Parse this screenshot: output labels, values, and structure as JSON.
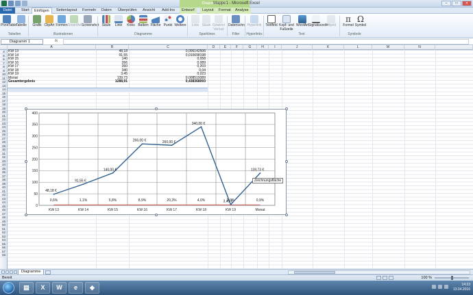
{
  "window": {
    "title": "Mappe1 - Microsoft Excel",
    "context_tool": "Diagrammtools",
    "controls": [
      "–",
      "□",
      "✕"
    ]
  },
  "tabs": [
    "Datei",
    "Start",
    "Einfügen",
    "Seitenlayout",
    "Formeln",
    "Daten",
    "Überprüfen",
    "Ansicht",
    "Add-Ins",
    "Entwurf",
    "Layout",
    "Format",
    "Analyse"
  ],
  "ribbon": {
    "buttons": [
      {
        "label": "PivotTable",
        "icon": "pivottable-icon"
      },
      {
        "label": "Tabelle",
        "icon": "table-icon"
      },
      {
        "label": "Grafik",
        "icon": "picture-icon"
      },
      {
        "label": "ClipArt",
        "icon": "clipart-icon"
      },
      {
        "label": "Formen",
        "icon": "shapes-icon"
      },
      {
        "label": "SmartArt",
        "icon": "smartart-icon"
      },
      {
        "label": "Screenshot",
        "icon": "screenshot-icon"
      },
      {
        "label": "Säule",
        "icon": "column-chart-icon"
      },
      {
        "label": "Linie",
        "icon": "line-chart-icon"
      },
      {
        "label": "Kreis",
        "icon": "pie-chart-icon"
      },
      {
        "label": "Balken",
        "icon": "bar-chart-icon"
      },
      {
        "label": "Fläche",
        "icon": "area-chart-icon"
      },
      {
        "label": "Punkt",
        "icon": "scatter-chart-icon"
      },
      {
        "label": "Weitere",
        "icon": "other-chart-icon"
      },
      {
        "label": "Linie",
        "icon": "sparkline-line-icon"
      },
      {
        "label": "Säule",
        "icon": "sparkline-column-icon"
      },
      {
        "label": "Gewinn/ Verlust",
        "icon": "winloss-icon"
      },
      {
        "label": "Datenschn.",
        "icon": "slicer-icon"
      },
      {
        "label": "Hyperlink",
        "icon": "hyperlink-icon"
      },
      {
        "label": "Textfeld",
        "icon": "textbox-icon"
      },
      {
        "label": "Kopf- und Fußzeile",
        "icon": "header-footer-icon"
      },
      {
        "label": "WordArt",
        "icon": "wordart-icon"
      },
      {
        "label": "Signaturzeile",
        "icon": "signature-icon"
      },
      {
        "label": "Objekt",
        "icon": "object-icon"
      },
      {
        "label": "Formel",
        "icon": "equation-icon",
        "glyph": "π"
      },
      {
        "label": "Symbol",
        "icon": "symbol-icon",
        "glyph": "Ω"
      }
    ],
    "groups": [
      "Tabellen",
      "Illustrationen",
      "Diagramme",
      "Sparklines",
      "Filter",
      "Hyperlinks",
      "Text",
      "Symbole"
    ]
  },
  "formula_bar": {
    "name_box": "Diagramm 1",
    "fx": "fx",
    "value": ""
  },
  "columns": [
    "A",
    "B",
    "C",
    "D",
    "E",
    "F",
    "G",
    "H",
    "I",
    "J",
    "K",
    "L",
    "M",
    "N"
  ],
  "rows": [
    "4",
    "5",
    "6",
    "7",
    "8",
    "9",
    "10",
    "11",
    "12",
    "13",
    "14",
    "15",
    "16",
    "17",
    "18",
    "19",
    "20",
    "21",
    "22",
    "23",
    "24",
    "25",
    "26",
    "27",
    "28",
    "29",
    "30",
    "31",
    "32",
    "33",
    "34",
    "35",
    "36",
    "37",
    "38",
    "39",
    "40",
    "41",
    "42",
    "43",
    "44",
    "45",
    "46",
    "47",
    "48",
    "49",
    "50",
    "51",
    "52",
    "53",
    "54",
    "55",
    "56",
    "57",
    "58"
  ],
  "table": [
    {
      "a": "KW 13",
      "b": "48,18",
      "c": "0,006142506"
    },
    {
      "a": "KW 14",
      "b": "91,55",
      "c": "0,010698198"
    },
    {
      "a": "KW 15",
      "b": "140",
      "c": "0,058"
    },
    {
      "a": "KW 16",
      "b": "266",
      "c": "0,089"
    },
    {
      "a": "KW 17",
      "b": "260",
      "c": "0,203"
    },
    {
      "a": "KW 18",
      "b": "340",
      "c": "0,04"
    },
    {
      "a": "KW 19",
      "b": "3,45",
      "c": "0,023"
    },
    {
      "a": "Monat",
      "b": "139,73",
      "c": "0,008519389"
    },
    {
      "a": "Gesamtergebnis",
      "b": "1288,91",
      "c": "0,438368093"
    }
  ],
  "chart_data": {
    "type": "line",
    "categories": [
      "KW 13",
      "KW 14",
      "KW 15",
      "KW 16",
      "KW 17",
      "KW 18",
      "KW 19",
      "Monat"
    ],
    "series": [
      {
        "values": [
          48.18,
          91.55,
          140,
          266,
          260,
          340,
          3.45,
          139.73
        ],
        "labels": [
          "48,18 €",
          "91,55 €",
          "140,00 €",
          "266,00 €",
          "260,00 €",
          "340,00 €",
          "3,45 €",
          "139,73 €"
        ],
        "color": "#2f5f8f"
      }
    ],
    "secondary_labels": [
      "0,6%",
      "1,1%",
      "5,8%",
      "8,9%",
      "20,3%",
      "4,0%",
      "2,3%",
      "0,9%"
    ],
    "secondary_color": "#c0504d",
    "ylim": [
      0,
      400
    ],
    "yticks": [
      0,
      50,
      100,
      150,
      200,
      250,
      300,
      350,
      400
    ],
    "grid": true,
    "tooltip": "Zeichnungsfläche"
  },
  "sheet_tabs": [
    "Diagramme"
  ],
  "status": {
    "mode": "Bereit",
    "zoom": "100 %"
  },
  "taskbar": {
    "apps": [
      {
        "name": "explorer",
        "glyph": "▤"
      },
      {
        "name": "excel",
        "glyph": "X"
      },
      {
        "name": "word",
        "glyph": "W"
      },
      {
        "name": "browser",
        "glyph": "e"
      },
      {
        "name": "app",
        "glyph": "◆"
      }
    ],
    "time": "14:23",
    "date": "13.04.2016"
  },
  "colors": {
    "accent": "#2a67b1",
    "chart_line": "#2f5f8f",
    "chart_secondary": "#c0504d",
    "context_tab": "#b5d88a"
  }
}
